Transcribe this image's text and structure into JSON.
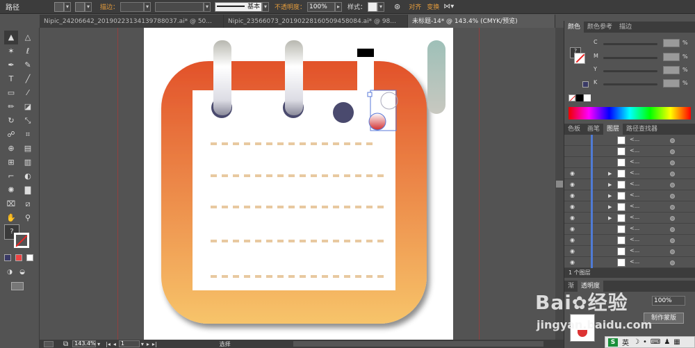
{
  "control_bar": {
    "object_label": "路径",
    "stroke_label": "描边：",
    "line_label": "基本",
    "opacity_label": "不透明度：",
    "opacity_value": "100%",
    "style_label": "样式：",
    "align_label": "对齐",
    "transform_label": "变换"
  },
  "tabs": [
    {
      "label": "Nipic_24206642_20190223134139788037.ai* @ 50..."
    },
    {
      "label": "Nipic_23566073_20190228160509458084.ai* @ 98..."
    },
    {
      "label": "未标题-14* @ 143.4% (CMYK/预览)"
    }
  ],
  "status_bar": {
    "zoom": "143.4%",
    "page": "1",
    "tool_hint": "选择"
  },
  "color_panel": {
    "tabs": [
      "颜色",
      "颜色参考",
      "描边"
    ],
    "channels": [
      {
        "label": "C",
        "pct": "%"
      },
      {
        "label": "M",
        "pct": "%"
      },
      {
        "label": "Y",
        "pct": "%"
      },
      {
        "label": "K",
        "pct": "%"
      }
    ]
  },
  "layers_panel": {
    "tabs": [
      "色板",
      "画笔",
      "图层",
      "路径查找器"
    ],
    "footer": "1 个图层",
    "row_name": "<..."
  },
  "lower_panel": {
    "tabs": [
      "渐",
      "透明度"
    ],
    "opacity": "100%",
    "make_mask": "制作蒙版"
  },
  "watermark": {
    "brand": "Bai",
    "brand2": "经验",
    "url": "jingyan.baidu.com"
  },
  "ime": {
    "label": "英"
  },
  "colors": {
    "orange_top": "#e2522a",
    "orange_bottom": "#f7c46a",
    "dash": "#e8c9a0",
    "ring": "#4a4a6e"
  }
}
